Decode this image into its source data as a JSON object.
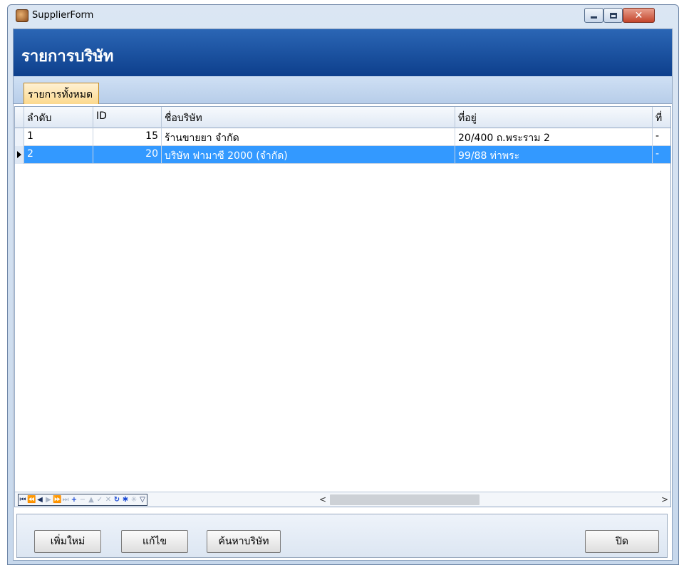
{
  "window": {
    "title": "SupplierForm"
  },
  "header": {
    "title": "รายการบริษัท"
  },
  "tabs": [
    {
      "label": "รายการทั้งหมด"
    }
  ],
  "grid": {
    "columns": [
      "ลำดับ",
      "ID",
      "ชื่อบริษัท",
      "ที่อยู่",
      "ที่"
    ],
    "rows": [
      {
        "seq": "1",
        "id": "15",
        "name": "ร้านขายยา จำกัด",
        "address": "20/400 ถ.พระราม 2",
        "extra": "-"
      },
      {
        "seq": "2",
        "id": "20",
        "name": "บริษัท ฟามาซี 2000 (จำกัด)",
        "address": "99/88 ท่าพระ",
        "extra": "-"
      }
    ],
    "selected_row": 1
  },
  "navigator": {
    "buttons": [
      "first",
      "prev-page",
      "prev",
      "next",
      "next-page",
      "last",
      "insert",
      "delete",
      "edit",
      "post",
      "cancel",
      "refresh",
      "bookmark",
      "goto-bookmark",
      "filter"
    ],
    "scroll_left": "<",
    "scroll_right": ">"
  },
  "actions": {
    "add_label": "เพิ่มใหม่",
    "edit_label": "แก้ไข",
    "search_label": "ค้นหาบริษัท",
    "close_label": "ปิด"
  },
  "colors": {
    "header_bg": "#1a4f9e",
    "selection": "#3399ff",
    "tab_bg": "#fbd98e"
  }
}
